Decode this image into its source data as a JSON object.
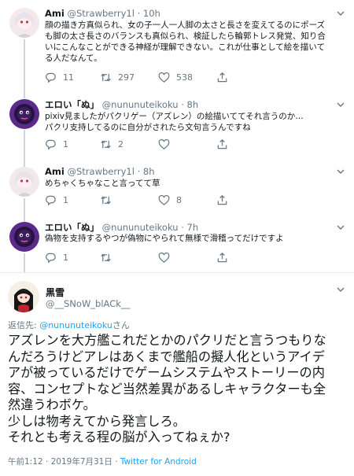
{
  "tweets": [
    {
      "name": "Ami",
      "handle": "@Strawberry1l",
      "dot": "·",
      "time": "10h",
      "lines": [
        "顔の描き方真似られ、女の子一人一人脚の太さと長さを変えてるのにポーズ",
        "も脚の太さ長さのバランスも真似られ、検証したら輪郭トレス発覚、知り合",
        "いにこんなことができる神経が理解できない。これが仕事として絵を描いて",
        "る人だなんて。"
      ],
      "replies": "11",
      "retweets": "297",
      "likes": "538"
    },
    {
      "name": "エロい「ぬ」",
      "handle": "@nununuteikoku",
      "dot": "·",
      "time": "8h",
      "lines": [
        "pixiv見ましたがパクリゲー（アズレン）の絵描いててそれ言うのか…",
        "パクリ支持してるのに自分がされたら文句言うんですね"
      ],
      "replies": "1",
      "retweets": "2",
      "likes": ""
    },
    {
      "name": "Ami",
      "handle": "@Strawberry1l",
      "dot": "·",
      "time": "8h",
      "lines": [
        "めちゃくちゃなこと言ってて草"
      ],
      "replies": "1",
      "retweets": "",
      "likes": "8"
    },
    {
      "name": "エロい「ぬ」",
      "handle": "@nununuteikoku",
      "dot": "·",
      "time": "7h",
      "lines": [
        "偽物を支持するやつが偽物にやられて無様で滑稽ってだけですよ"
      ],
      "replies": "1",
      "retweets": "",
      "likes": ""
    }
  ],
  "main": {
    "name": "黒雪",
    "handle": "@__SNoW_blACk__",
    "reply_prefix": "返信先: ",
    "reply_handle": "@nununuteikoku",
    "reply_suffix": "さん",
    "lines": [
      "アズレンを大方艦これだとかのパクリだと言うつもりな",
      "んだろうけどアレはあくまで艦船の擬人化というアイデ",
      "アが被っているだけでゲームシステムやストーリーの内",
      "容、コンセプトなど当然差異があるしキャラクターも全",
      "然違うわボケ。",
      "少しは物考えてから発言しろ。",
      "それとも考える程の脳が入ってねぇか?"
    ],
    "timestamp": "午前1:12 · 2019年7月31日 · ",
    "via": "Twitter for Android"
  },
  "icons": [
    "reply-icon",
    "retweet-icon",
    "like-icon",
    "share-icon",
    "chevron-down-icon"
  ],
  "colors": {
    "accent": "#1da1f2",
    "muted": "#657786",
    "divider": "#e6ecf0",
    "thread": "#ccd6dd"
  }
}
